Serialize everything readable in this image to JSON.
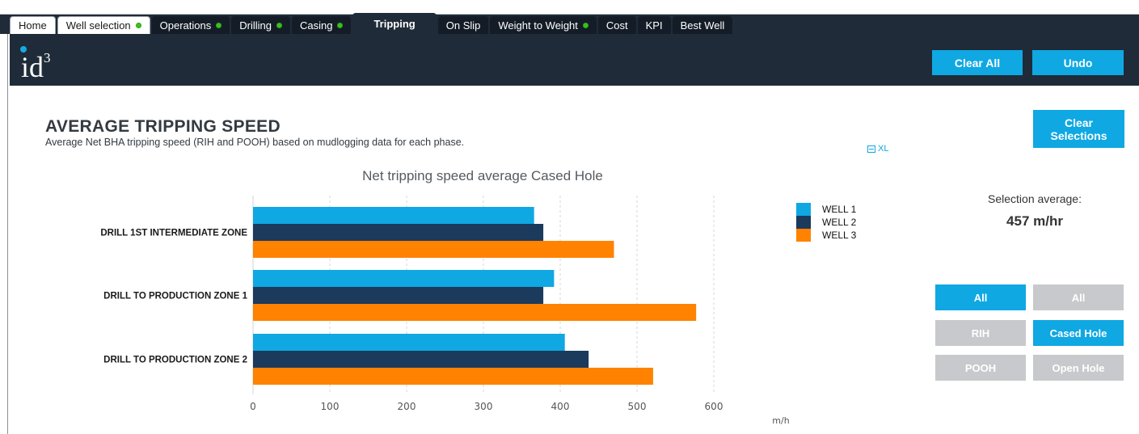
{
  "tabs": [
    {
      "label": "Home",
      "style": "light",
      "status": false
    },
    {
      "label": "Well selection",
      "style": "light",
      "status": true
    },
    {
      "label": "Operations",
      "style": "dark",
      "status": true
    },
    {
      "label": "Drilling",
      "style": "dark",
      "status": true
    },
    {
      "label": "Casing",
      "style": "dark",
      "status": true
    },
    {
      "label": "Tripping",
      "style": "active",
      "status": false
    },
    {
      "label": "On Slip",
      "style": "dark",
      "status": false
    },
    {
      "label": "Weight to Weight",
      "style": "dark",
      "status": true
    },
    {
      "label": "Cost",
      "style": "dark",
      "status": false
    },
    {
      "label": "KPI",
      "style": "dark",
      "status": false
    },
    {
      "label": "Best Well",
      "style": "dark",
      "status": false
    }
  ],
  "header": {
    "logo_text": "id",
    "logo_sup": "3",
    "clear_all_label": "Clear All",
    "undo_label": "Undo"
  },
  "page": {
    "title": "AVERAGE TRIPPING SPEED",
    "subtitle": "Average Net BHA tripping speed (RIH and POOH) based on mudlogging data for each phase.",
    "export_label": "XL",
    "clear_selections_label": "Clear Selections"
  },
  "panel": {
    "selection_label": "Selection average:",
    "selection_value": "457 m/hr",
    "buttons": [
      {
        "label": "All",
        "active": true
      },
      {
        "label": "All",
        "active": false
      },
      {
        "label": "RIH",
        "active": false
      },
      {
        "label": "Cased Hole",
        "active": true
      },
      {
        "label": "POOH",
        "active": false
      },
      {
        "label": "Open Hole",
        "active": false
      }
    ]
  },
  "chart_data": {
    "type": "bar",
    "orientation": "horizontal",
    "title": "Net tripping speed average Cased Hole",
    "xlabel": "m/h",
    "ylabel": "",
    "xlim": [
      0,
      600
    ],
    "xticks": [
      0,
      100,
      200,
      300,
      400,
      500,
      600
    ],
    "grid": true,
    "legend_position": "right",
    "categories": [
      "DRILL 1ST INTERMEDIATE ZONE",
      "DRILL TO PRODUCTION ZONE 1",
      "DRILL TO PRODUCTION ZONE 2"
    ],
    "series": [
      {
        "name": "WELL 1",
        "color": "#0fa8e2",
        "values": [
          366,
          392,
          406
        ]
      },
      {
        "name": "WELL 2",
        "color": "#1b3a5c",
        "values": [
          378,
          378,
          437
        ]
      },
      {
        "name": "WELL 3",
        "color": "#ff8200",
        "values": [
          470,
          577,
          521
        ]
      }
    ]
  },
  "colors": {
    "accent": "#0fa8e2",
    "header_dark": "#1f2b38",
    "inactive_button": "#c7c9cc",
    "status_dot": "#39c21c"
  }
}
